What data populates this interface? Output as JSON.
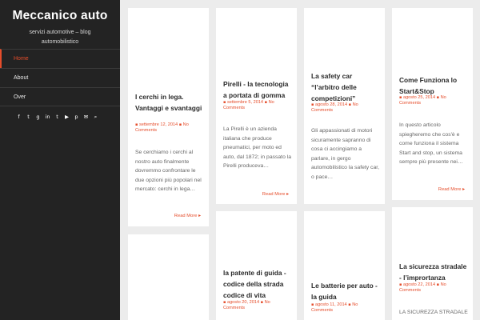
{
  "site": {
    "title": "Meccanico auto",
    "description": "servizi automotive – blog automobilistico"
  },
  "nav": [
    {
      "label": "Home"
    },
    {
      "label": "About"
    },
    {
      "label": "Over"
    }
  ],
  "social_icons": [
    "facebook-icon",
    "twitter-icon",
    "google-plus-icon",
    "linkedin-icon",
    "tumblr-icon",
    "youtube-icon",
    "pinterest-icon",
    "email-icon",
    "search-icon"
  ],
  "accent_color": "#e54d2b",
  "read_more": "Read More ▸",
  "posts": [
    {
      "title": "I cerchi in lega. Vantaggi e svantaggi",
      "date": "settembre 12, 2014",
      "comments": "No Comments",
      "excerpt": "Se cerchiamo i cerchi al nostro auto finalmente dovremmo confrontare le due opzioni più popolari nel mercato: cerchi in lega…"
    },
    {
      "title": "Pirelli - la tecnologia a portata di gomma",
      "date": "settembre 5, 2014",
      "comments": "No Comments",
      "excerpt": "La Pirelli è un azienda italiana che produce pneumatici, per moto ed auto, dal 1872; in passato la Pirelli produceva…"
    },
    {
      "title": "La safety car “l’arbitro delle competizioni”",
      "date": "agosto 28, 2014",
      "comments": "No Comments",
      "excerpt": "Gli appassionati di motori sicuramente sapranno di cosa ci accingiamo a parlare, in gergo automobilistico la safety car, o pace…"
    },
    {
      "title": "Come Funziona lo Start&Stop",
      "date": "agosto 25, 2014",
      "comments": "No Comments",
      "excerpt": "In questo articolo spiegheremo che cos'è e come funziona il sistema Start and stop, un sistema sempre più presente nei…"
    },
    {
      "title": "la patente di guida - codice della strada codice di vita",
      "date": "agosto 20, 2014",
      "comments": "No Comments"
    },
    {
      "title": "Le batterie per auto - la guida",
      "date": "agosto 11, 2014",
      "comments": "No Comments"
    },
    {
      "title": "La sicurezza stradale - l’imprortanza",
      "date": "agosto 22, 2014",
      "comments": "No Comments",
      "excerpt": "LA SICUREZZA STRADALE"
    }
  ]
}
